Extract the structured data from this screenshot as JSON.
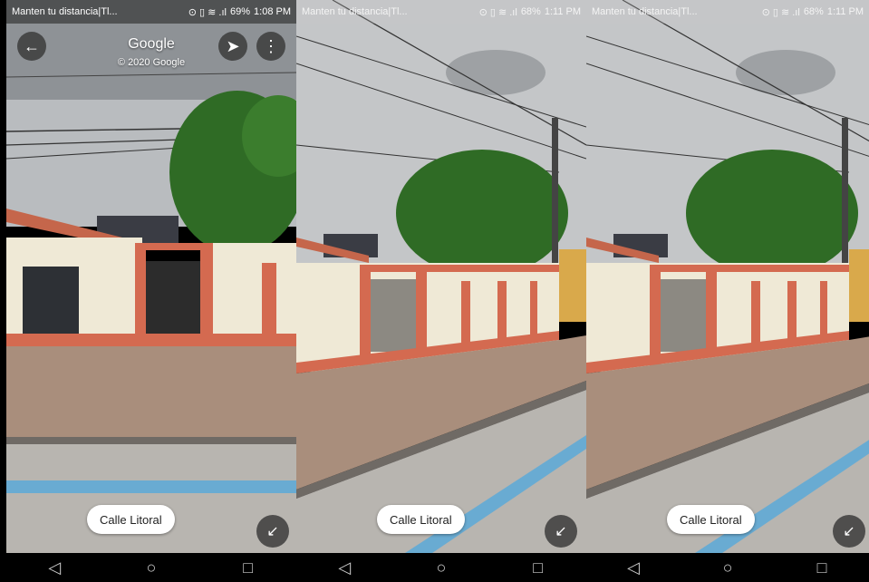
{
  "panels": [
    {
      "status": {
        "notification": "Manten tu distancia|Tl...",
        "icons": "⊙ ▯ ≋ .ıl",
        "battery": "69%",
        "time": "1:08 PM"
      },
      "header": {
        "title": "Google",
        "copyright": "© 2020 Google",
        "back_icon": "arrow-left",
        "compass_icon": "compass",
        "menu_icon": "more-vert"
      },
      "street_label": "Calle Litoral",
      "nav": {
        "back": "◁",
        "home": "○",
        "recents": "□"
      }
    },
    {
      "status": {
        "notification": "Manten tu distancia|Tl...",
        "icons": "⊙ ▯ ≋ .ıl",
        "battery": "68%",
        "time": "1:11 PM"
      },
      "street_label": "Calle Litoral",
      "nav": {
        "back": "◁",
        "home": "○",
        "recents": "□"
      }
    },
    {
      "status": {
        "notification": "Manten tu distancia|Tl...",
        "icons": "⊙ ▯ ≋ .ıl",
        "battery": "68%",
        "time": "1:11 PM"
      },
      "street_label": "Calle Litoral",
      "nav": {
        "back": "◁",
        "home": "○",
        "recents": "□"
      }
    }
  ],
  "colors": {
    "sky": "#b9bcbf",
    "tree": "#2f6b25",
    "wall": "#efe9d6",
    "trim": "#d46a50",
    "sidewalk": "#a98e7c",
    "road": "#b8b5b0",
    "road_line": "#5aa9d8"
  }
}
